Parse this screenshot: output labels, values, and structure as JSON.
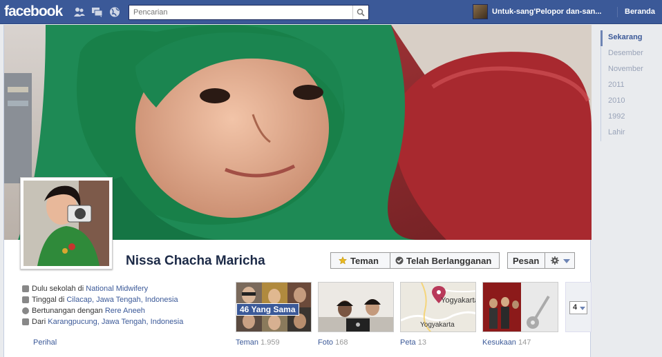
{
  "topbar": {
    "logo": "facebook",
    "search_placeholder": "Pencarian",
    "user_name": "Untuk-sang'Pelopor dan-san...",
    "home_label": "Beranda"
  },
  "profile": {
    "name": "Nissa Chacha Maricha",
    "buttons": {
      "friend": "Teman",
      "subscribed": "Telah Berlangganan",
      "message": "Pesan"
    }
  },
  "info": {
    "school_prefix": "Dulu sekolah di ",
    "school": "National Midwifery",
    "lives_prefix": "Tinggal di ",
    "lives": "Cilacap, Jawa Tengah, Indonesia",
    "relationship_prefix": "Bertunangan dengan ",
    "relationship": "Rere Aneeh",
    "from_prefix": "Dari ",
    "from": "Karangpucung, Jawa Tengah, Indonesia",
    "about_link": "Perihal"
  },
  "tiles": {
    "friends": {
      "label": "Teman",
      "count": "1.959",
      "mutual": "46 Yang Sama"
    },
    "photos": {
      "label": "Foto",
      "count": "168"
    },
    "map": {
      "label": "Peta",
      "count": "13",
      "city_top": "Yogyakarta",
      "city_bottom": "Yogyakarta"
    },
    "likes": {
      "label": "Kesukaan",
      "count": "147"
    },
    "more": "4"
  },
  "timeline": [
    "Sekarang",
    "Desember",
    "November",
    "2011",
    "2010",
    "1992",
    "Lahir"
  ],
  "colors": {
    "brand": "#3b5998",
    "cover_scarf": "#1f8a55",
    "cover_sofa": "#9c2f33"
  }
}
